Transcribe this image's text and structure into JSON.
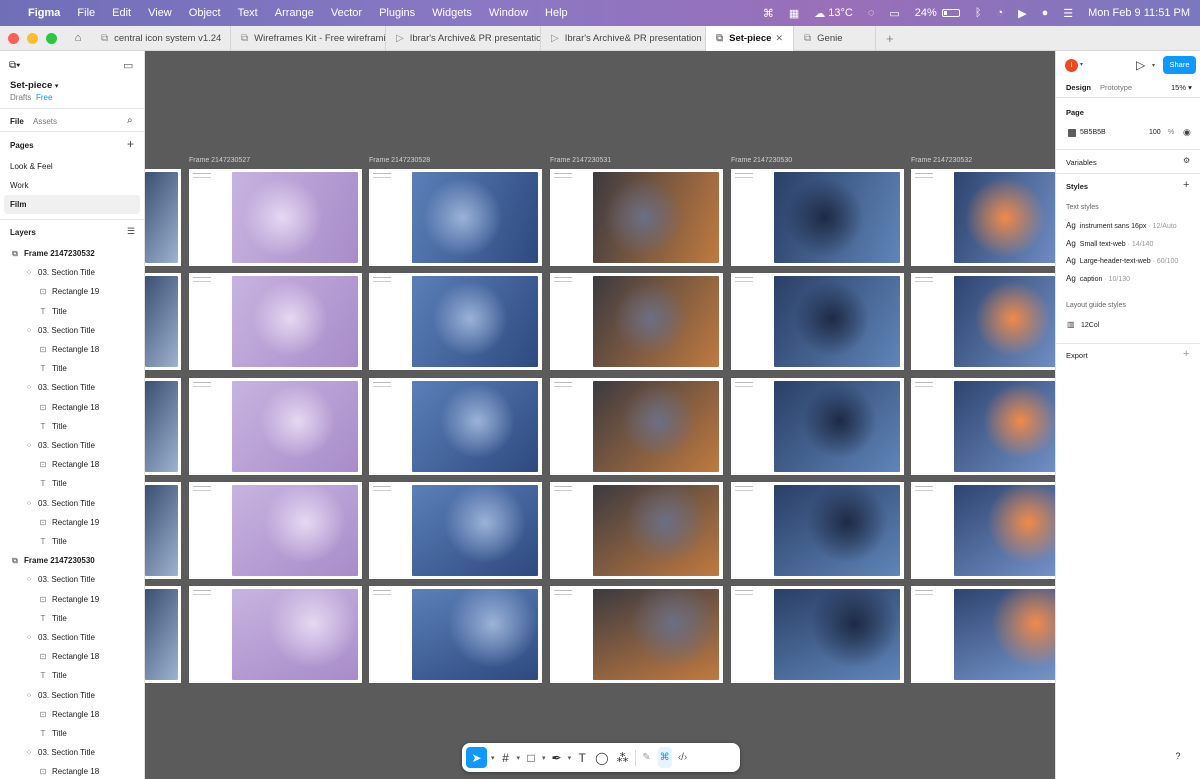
{
  "menubar": {
    "app": "Figma",
    "items": [
      "File",
      "Edit",
      "View",
      "Object",
      "Text",
      "Arrange",
      "Vector",
      "Plugins",
      "Widgets",
      "Window",
      "Help"
    ],
    "weather": "13°C",
    "battery": "24%",
    "datetime": "Mon Feb 9  11:51 PM"
  },
  "tabs": [
    {
      "label": "central icon system v1.24",
      "active": false
    },
    {
      "label": "Wireframes Kit - Free wireframing Web",
      "active": false
    },
    {
      "label": "Ibrar's Archive& PR presentation style",
      "active": false
    },
    {
      "label": "Ibrar's Archive& PR presentation style",
      "active": false
    },
    {
      "label": "Set-piece",
      "active": true
    },
    {
      "label": "Genie",
      "active": false
    }
  ],
  "left": {
    "file_name": "Set-piece",
    "drafts": "Drafts",
    "plan": "Free",
    "tab_file": "File",
    "tab_assets": "Assets",
    "pages_label": "Pages",
    "pages": [
      "Look & Feel",
      "Work",
      "Film"
    ],
    "layers_label": "Layers",
    "layers": [
      {
        "name": "Frame 2147230532",
        "level": 0,
        "icon": "frame"
      },
      {
        "name": "03. Section Title",
        "level": 1,
        "icon": "grid"
      },
      {
        "name": "Rectangle 19",
        "level": 2,
        "icon": "image"
      },
      {
        "name": "Title",
        "level": 2,
        "icon": "text"
      },
      {
        "name": "03. Section Title",
        "level": 1,
        "icon": "grid"
      },
      {
        "name": "Rectangle 18",
        "level": 2,
        "icon": "image"
      },
      {
        "name": "Title",
        "level": 2,
        "icon": "text"
      },
      {
        "name": "03. Section Title",
        "level": 1,
        "icon": "grid"
      },
      {
        "name": "Rectangle 18",
        "level": 2,
        "icon": "image"
      },
      {
        "name": "Title",
        "level": 2,
        "icon": "text"
      },
      {
        "name": "03. Section Title",
        "level": 1,
        "icon": "grid"
      },
      {
        "name": "Rectangle 18",
        "level": 2,
        "icon": "image"
      },
      {
        "name": "Title",
        "level": 2,
        "icon": "text"
      },
      {
        "name": "03. Section Title",
        "level": 1,
        "icon": "grid"
      },
      {
        "name": "Rectangle 19",
        "level": 2,
        "icon": "image"
      },
      {
        "name": "Title",
        "level": 2,
        "icon": "text"
      },
      {
        "name": "Frame 2147230530",
        "level": 0,
        "icon": "frame"
      },
      {
        "name": "03. Section Title",
        "level": 1,
        "icon": "grid"
      },
      {
        "name": "Rectangle 19",
        "level": 2,
        "icon": "image"
      },
      {
        "name": "Title",
        "level": 2,
        "icon": "text"
      },
      {
        "name": "03. Section Title",
        "level": 1,
        "icon": "grid"
      },
      {
        "name": "Rectangle 18",
        "level": 2,
        "icon": "image"
      },
      {
        "name": "Title",
        "level": 2,
        "icon": "text"
      },
      {
        "name": "03. Section Title",
        "level": 1,
        "icon": "grid"
      },
      {
        "name": "Rectangle 18",
        "level": 2,
        "icon": "image"
      },
      {
        "name": "Title",
        "level": 2,
        "icon": "text"
      },
      {
        "name": "03. Section Title",
        "level": 1,
        "icon": "grid"
      },
      {
        "name": "Rectangle 18",
        "level": 2,
        "icon": "image"
      }
    ]
  },
  "canvas": {
    "frames": [
      "Frame 2147230527",
      "Frame 2147230528",
      "Frame 2147230531",
      "Frame 2147230530",
      "Frame 2147230532"
    ],
    "background": "#5B5B5B"
  },
  "right": {
    "avatar_letter": "I",
    "share": "Share",
    "tab_design": "Design",
    "tab_prototype": "Prototype",
    "zoom": "15%",
    "page_label": "Page",
    "page_color": "5B5B5B",
    "page_opacity": "100",
    "percent": "%",
    "variables": "Variables",
    "styles": "Styles",
    "text_styles_label": "Text styles",
    "text_styles": [
      {
        "name": "instrument sans 16px",
        "meta": " · 12/Auto"
      },
      {
        "name": "Small text-web",
        "meta": " · 14/140"
      },
      {
        "name": "Large-header-text-web",
        "meta": " · 60/100"
      },
      {
        "name": "caption",
        "meta": " · 10/130"
      }
    ],
    "layout_guide_label": "Layout guide styles",
    "layout_guide": "12Col",
    "export": "Export"
  },
  "help": "?"
}
